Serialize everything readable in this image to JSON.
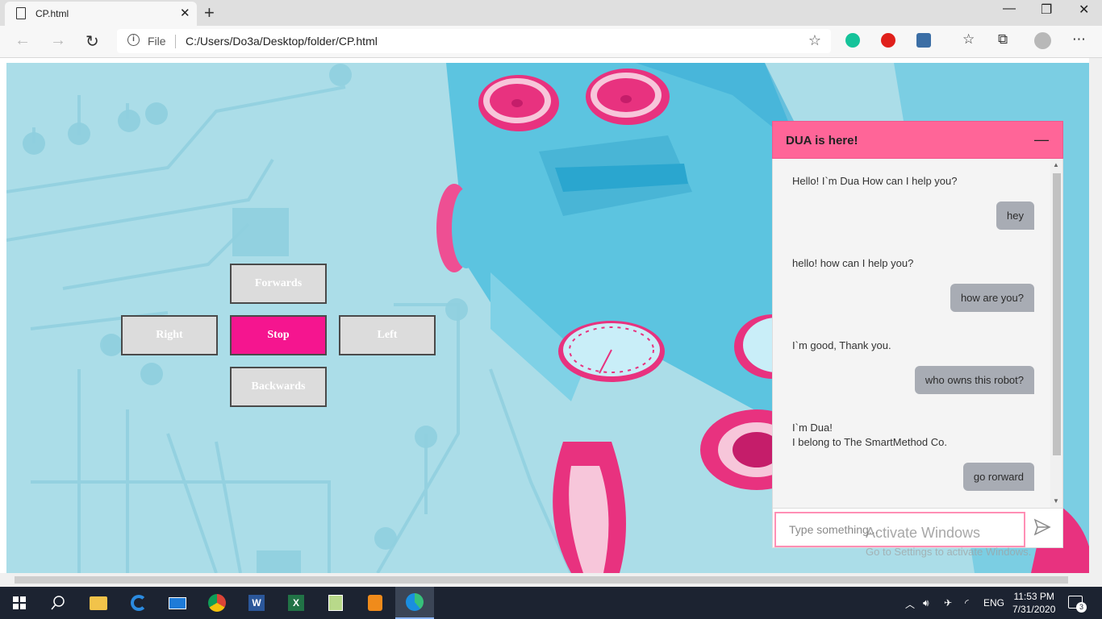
{
  "browser": {
    "tab_title": "CP.html",
    "address_scheme": "File",
    "address_url": "C:/Users/Do3a/Desktop/folder/CP.html"
  },
  "controls": {
    "forwards": "Forwards",
    "right": "Right",
    "stop": "Stop",
    "left": "Left",
    "backwards": "Backwards"
  },
  "chat": {
    "title": "DUA is here!",
    "messages": [
      {
        "from": "bot",
        "text": "Hello! I`m Dua How can I help you?"
      },
      {
        "from": "user",
        "text": "hey"
      },
      {
        "from": "bot",
        "text": "hello! how can I help you?"
      },
      {
        "from": "user",
        "text": "how are you?"
      },
      {
        "from": "bot",
        "text": "I`m good, Thank you."
      },
      {
        "from": "user",
        "text": "who owns this robot?"
      },
      {
        "from": "bot",
        "text": "I`m Dua!"
      },
      {
        "from": "bot",
        "text": "I belong to The SmartMethod Co."
      },
      {
        "from": "user",
        "text": "go rorward"
      }
    ],
    "input_placeholder": "Type something..."
  },
  "watermark": {
    "title": "Activate Windows",
    "subtitle": "Go to Settings to activate Windows."
  },
  "taskbar": {
    "language": "ENG",
    "time": "11:53 PM",
    "date": "7/31/2020",
    "notification_count": "3"
  },
  "colors": {
    "accent_pink": "#f5158f",
    "chat_header": "#ff6598",
    "page_bg": "#abdde8",
    "robot_blue": "#5cc4e0"
  }
}
